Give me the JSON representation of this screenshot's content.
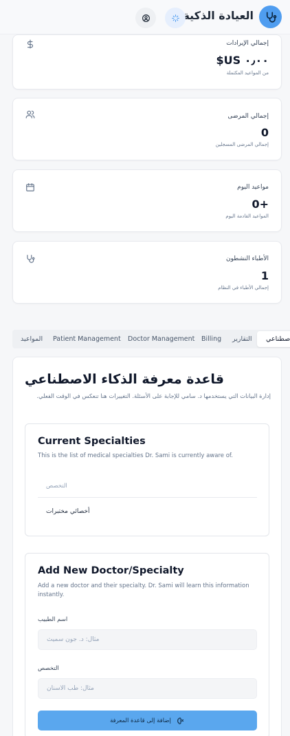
{
  "header": {
    "app_name": "العيادة الذكية",
    "logo_icon": "stethoscope-icon",
    "sparkle_icon": "sparkle-icon",
    "user_icon": "user-circle-icon"
  },
  "stats": [
    {
      "title": "إجمالي الإيرادات",
      "value": "$US ٠٫٠٠",
      "sub": "من المواعيد المكتملة",
      "icon": "dollar-icon"
    },
    {
      "title": "إجمالي المرضى",
      "value": "0",
      "sub": "إجمالي المرضى المسجلين",
      "icon": "users-icon"
    },
    {
      "title": "مواعيد اليوم",
      "value": "0+",
      "sub": "المواعيد القادمة اليوم",
      "icon": "calendar-icon"
    },
    {
      "title": "الأطباء النشطون",
      "value": "1",
      "sub": "إجمالي الأطباء في النظام",
      "icon": "stethoscope-icon"
    }
  ],
  "tabs": [
    {
      "label": "المواعيد"
    },
    {
      "label": "Patient Management"
    },
    {
      "label": "Doctor Management"
    },
    {
      "label": "Billing"
    },
    {
      "label": "التقارير"
    },
    {
      "label": "الذكاء الاصطناعي",
      "active": true
    }
  ],
  "knowledge_base": {
    "title": "قاعدة معرفة الذكاء الاصطناعي",
    "description": "إدارة البيانات التي يستخدمها د. سامي للإجابة على الأسئلة. التغييرات هنا تنعكس في الوقت الفعلي."
  },
  "current_specialties": {
    "title": "Current Specialties",
    "description": "This is the list of medical specialties Dr. Sami is currently aware of.",
    "column_header": "التخصص",
    "rows": [
      "أخصائي مختبرات"
    ]
  },
  "add_doctor": {
    "title": "Add New Doctor/Specialty",
    "description": "Add a new doctor and their specialty. Dr. Sami will learn this information instantly.",
    "name_label": "اسم الطبيب",
    "name_placeholder": "مثال: د. جون سميث",
    "specialty_label": "التخصص",
    "specialty_placeholder": "مثال: طب الأسنان",
    "submit_label": "إضافة إلى قاعدة المعرفة"
  },
  "colors": {
    "accent": "#4f9df0",
    "submit": "#5aa7ee",
    "text": "#0f172a",
    "muted": "#64748b"
  }
}
